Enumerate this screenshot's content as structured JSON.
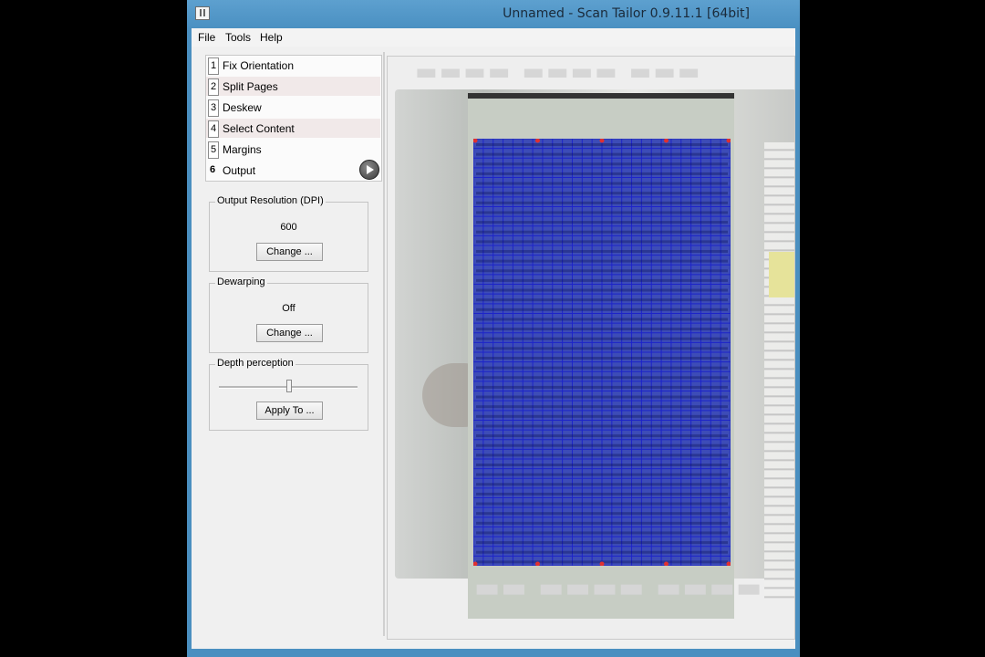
{
  "window": {
    "title": "Unnamed - Scan Tailor 0.9.11.1 [64bit]"
  },
  "menu": {
    "items": [
      "File",
      "Tools",
      "Help"
    ]
  },
  "stages": [
    {
      "num": "1",
      "label": "Fix Orientation"
    },
    {
      "num": "2",
      "label": "Split Pages"
    },
    {
      "num": "3",
      "label": "Deskew"
    },
    {
      "num": "4",
      "label": "Select Content"
    },
    {
      "num": "5",
      "label": "Margins"
    },
    {
      "num": "6",
      "label": "Output"
    }
  ],
  "output_resolution": {
    "title": "Output Resolution (DPI)",
    "value": "600",
    "button": "Change ..."
  },
  "dewarping": {
    "title": "Dewarping",
    "value": "Off",
    "button": "Change ..."
  },
  "depth": {
    "title": "Depth perception",
    "button": "Apply To ..."
  },
  "colors": {
    "grid": "#1d24c8",
    "grid_fill": "#1e2fb4",
    "handle": "#e03030",
    "title_bar": "#4a8fc0"
  }
}
